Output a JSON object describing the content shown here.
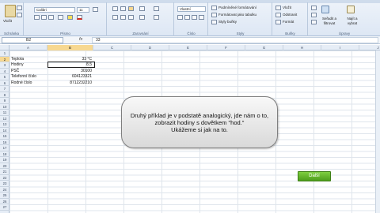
{
  "ribbon": {
    "clipboard": {
      "paste_label": "Vložit",
      "group_label": "Schránka"
    },
    "font": {
      "font_name": "Calibri",
      "font_size": "11",
      "group_label": "Písmo"
    },
    "alignment": {
      "group_label": "Zarovnání"
    },
    "number": {
      "format_label": "Vlastní",
      "group_label": "Číslo"
    },
    "styles": {
      "conditional_label": "Podmíněné formátování",
      "table_label": "Formátovat jako tabulku",
      "cell_styles_label": "Styly buňky",
      "group_label": "Styly"
    },
    "cells": {
      "insert_label": "Vložit",
      "delete_label": "Odstranit",
      "format_label": "Formát",
      "group_label": "Buňky"
    },
    "editing": {
      "sort_label": "Seřadit a filtrovat",
      "find_label": "Najít a vybrat",
      "group_label": "Úpravy"
    }
  },
  "formula_bar": {
    "name_box": "B2",
    "fx_label": "fx",
    "content": "33"
  },
  "columns": [
    "A",
    "B",
    "C",
    "D",
    "E",
    "F",
    "G",
    "H",
    "I",
    "J"
  ],
  "rows": [
    "1",
    "2",
    "3",
    "4",
    "5",
    "6",
    "7",
    "8",
    "9",
    "10",
    "11",
    "12",
    "13",
    "14",
    "15",
    "16",
    "17",
    "18",
    "19",
    "20",
    "21",
    "22",
    "23",
    "24",
    "25",
    "26",
    "27"
  ],
  "table": [
    {
      "label": "Teplota",
      "value": "33 °C"
    },
    {
      "label": "Hodiny",
      "value": "8,5"
    },
    {
      "label": "PSČ",
      "value": "30100"
    },
    {
      "label": "Telefonní číslo",
      "value": "604123321"
    },
    {
      "label": "Rodné číslo",
      "value": "8712232210"
    }
  ],
  "callout": {
    "line1": "Druhý příklad je v podstatě analogický, jde nám o to,",
    "line2": "zobrazit hodiny s dovětkem \"hod.\"",
    "line3": "Ukážeme si jak na to."
  },
  "next_button": {
    "label": "Další"
  },
  "colors": {
    "accent": "#5aa824",
    "active_header": "#f7d891"
  }
}
